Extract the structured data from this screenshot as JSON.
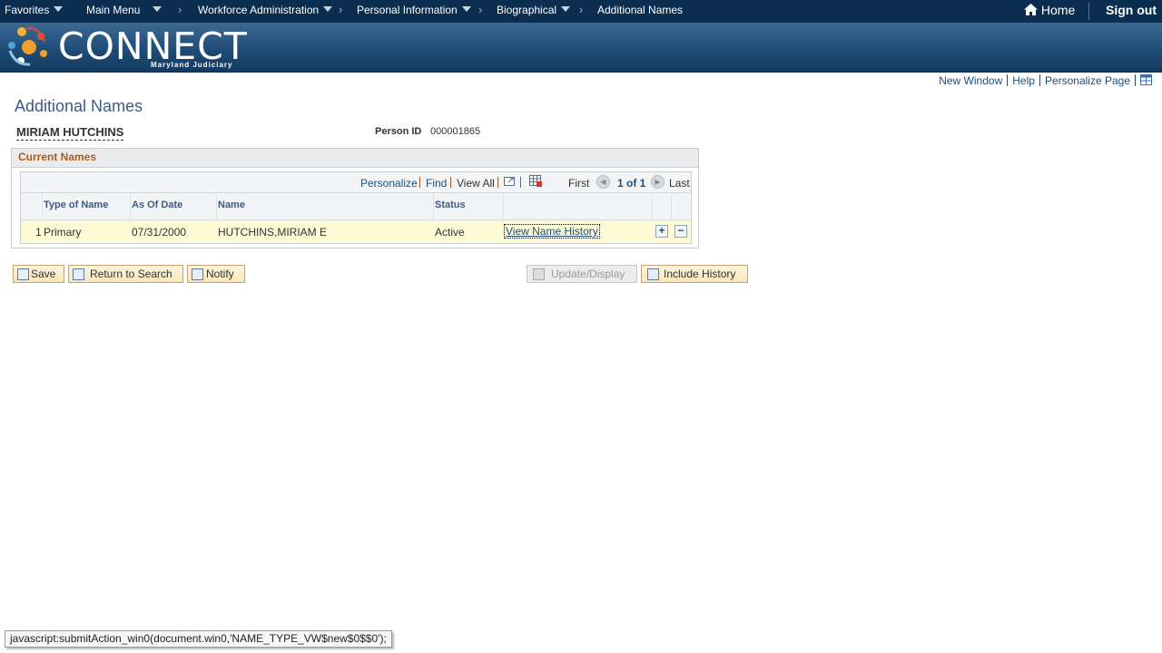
{
  "topnav": {
    "favorites": "Favorites",
    "main_menu": "Main Menu",
    "crumbs": [
      "Workforce Administration",
      "Personal Information",
      "Biographical",
      "Additional Names"
    ],
    "home": "Home",
    "signout": "Sign out"
  },
  "logo": {
    "word": "CONNECT",
    "sub": "Maryland Judiciary"
  },
  "pagelinks": {
    "new_window": "New Window",
    "help": "Help",
    "personalize": "Personalize Page"
  },
  "page": {
    "title": "Additional Names",
    "person_name": "MIRIAM HUTCHINS",
    "person_id_label": "Person ID",
    "person_id": "000001865"
  },
  "group": {
    "title": "Current Names",
    "nav": {
      "personalize": "Personalize",
      "find": "Find",
      "view_all": "View All",
      "first": "First",
      "count": "1 of 1",
      "last": "Last"
    },
    "columns": [
      "Type of Name",
      "As Of Date",
      "Name",
      "Status"
    ],
    "rows": [
      {
        "num": "1",
        "type": "Primary",
        "date": "07/31/2000",
        "name": "HUTCHINS,MIRIAM E",
        "status": "Active",
        "link": "View Name History"
      }
    ]
  },
  "buttons": {
    "save": "Save",
    "return": "Return to Search",
    "notify": "Notify",
    "update": "Update/Display",
    "include": "Include History"
  },
  "statusbar": "javascript:submitAction_win0(document.win0,'NAME_TYPE_VW$new$0$$0');",
  "colors": {
    "nav_bg": "#0b2d4f",
    "link": "#1e4e7c",
    "group_title": "#b35a1b",
    "row_highlight": "#fdfad6"
  }
}
